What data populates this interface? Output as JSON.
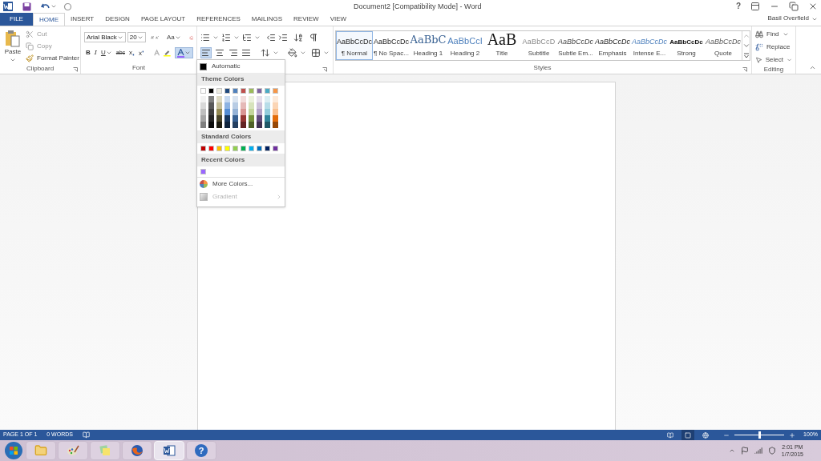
{
  "title_bar": {
    "title": "Document2 [Compatibility Mode] - Word",
    "help": "?",
    "user": "Basil Overfield"
  },
  "tabs": [
    {
      "label": "FILE",
      "kind": "file",
      "selected": false
    },
    {
      "label": "HOME",
      "kind": "tab",
      "selected": true
    },
    {
      "label": "INSERT",
      "kind": "tab",
      "selected": false
    },
    {
      "label": "DESIGN",
      "kind": "tab",
      "selected": false
    },
    {
      "label": "PAGE LAYOUT",
      "kind": "tab",
      "selected": false
    },
    {
      "label": "REFERENCES",
      "kind": "tab",
      "selected": false
    },
    {
      "label": "MAILINGS",
      "kind": "tab",
      "selected": false
    },
    {
      "label": "REVIEW",
      "kind": "tab",
      "selected": false
    },
    {
      "label": "VIEW",
      "kind": "tab",
      "selected": false
    }
  ],
  "clipboard": {
    "paste": "Paste",
    "cut": "Cut",
    "copy": "Copy",
    "format_painter": "Format Painter",
    "label": "Clipboard"
  },
  "font": {
    "font_name": "Arial Black",
    "font_size": "20",
    "change_case": "Aa",
    "bold": "B",
    "italic": "I",
    "underline": "U",
    "strikethrough": "abc",
    "label": "Font",
    "font_color_open": true
  },
  "paragraph": {
    "alignments": [
      {
        "kind": "left",
        "selected": true
      },
      {
        "kind": "center",
        "selected": false
      },
      {
        "kind": "right",
        "selected": false
      },
      {
        "kind": "justify",
        "selected": false
      }
    ]
  },
  "styles": {
    "label": "Styles",
    "items": [
      {
        "preview": "AaBbCcDc",
        "name": "¶ Normal",
        "kind": "normal",
        "selected": true
      },
      {
        "preview": "AaBbCcDc",
        "name": "¶ No Spac...",
        "kind": "normal",
        "selected": false
      },
      {
        "preview": "AaBbC",
        "name": "Heading 1",
        "kind": "heading1",
        "selected": false
      },
      {
        "preview": "AaBbCcI",
        "name": "Heading 2",
        "kind": "heading2",
        "selected": false
      },
      {
        "preview": "AaB",
        "name": "Title",
        "kind": "title",
        "selected": false
      },
      {
        "preview": "AaBbCcD",
        "name": "Subtitle",
        "kind": "subtitle",
        "selected": false
      },
      {
        "preview": "AaBbCcDc",
        "name": "Subtle Em...",
        "kind": "subtle",
        "selected": false
      },
      {
        "preview": "AaBbCcDc",
        "name": "Emphasis",
        "kind": "emphasis",
        "selected": false
      },
      {
        "preview": "AaBbCcDc",
        "name": "Intense E...",
        "kind": "intense",
        "selected": false
      },
      {
        "preview": "AaBbCcDc",
        "name": "Strong",
        "kind": "strong",
        "selected": false
      },
      {
        "preview": "AaBbCcDc",
        "name": "Quote",
        "kind": "quote",
        "selected": false
      }
    ]
  },
  "editing": {
    "find": "Find",
    "replace": "Replace",
    "select": "Select",
    "label": "Editing"
  },
  "color_menu": {
    "automatic": "Automatic",
    "theme_header": "Theme Colors",
    "theme_colors": [
      {
        "color": "#ffffff",
        "shades": [
          {
            "color": "#f2f2f2"
          },
          {
            "color": "#d9d9d9"
          },
          {
            "color": "#bfbfbf"
          },
          {
            "color": "#a6a6a6"
          },
          {
            "color": "#808080"
          }
        ]
      },
      {
        "color": "#000000",
        "shades": [
          {
            "color": "#808080"
          },
          {
            "color": "#595959"
          },
          {
            "color": "#404040"
          },
          {
            "color": "#262626"
          },
          {
            "color": "#0d0d0d"
          }
        ]
      },
      {
        "color": "#eeece1",
        "shades": [
          {
            "color": "#ddd9c3"
          },
          {
            "color": "#c4bd97"
          },
          {
            "color": "#948a54"
          },
          {
            "color": "#4a452a"
          },
          {
            "color": "#1e1c11"
          }
        ]
      },
      {
        "color": "#1f497d",
        "shades": [
          {
            "color": "#c6d9f0"
          },
          {
            "color": "#8db3e2"
          },
          {
            "color": "#548dd4"
          },
          {
            "color": "#17365d"
          },
          {
            "color": "#0f243e"
          }
        ]
      },
      {
        "color": "#4f81bd",
        "shades": [
          {
            "color": "#dbe5f1"
          },
          {
            "color": "#b8cce4"
          },
          {
            "color": "#95b3d7"
          },
          {
            "color": "#366092"
          },
          {
            "color": "#244061"
          }
        ]
      },
      {
        "color": "#c0504d",
        "shades": [
          {
            "color": "#f2dcdb"
          },
          {
            "color": "#e5b9b7"
          },
          {
            "color": "#d99694"
          },
          {
            "color": "#953734"
          },
          {
            "color": "#632423"
          }
        ]
      },
      {
        "color": "#9bbb59",
        "shades": [
          {
            "color": "#ebf1dd"
          },
          {
            "color": "#d7e3bc"
          },
          {
            "color": "#c3d69b"
          },
          {
            "color": "#76923c"
          },
          {
            "color": "#4f6128"
          }
        ]
      },
      {
        "color": "#8064a2",
        "shades": [
          {
            "color": "#e5e0ec"
          },
          {
            "color": "#ccc1d9"
          },
          {
            "color": "#b2a2c7"
          },
          {
            "color": "#5f497a"
          },
          {
            "color": "#3f3151"
          }
        ]
      },
      {
        "color": "#4bacc6",
        "shades": [
          {
            "color": "#dbeef3"
          },
          {
            "color": "#b7dde8"
          },
          {
            "color": "#92cddc"
          },
          {
            "color": "#31859b"
          },
          {
            "color": "#205867"
          }
        ]
      },
      {
        "color": "#f79646",
        "shades": [
          {
            "color": "#fdeada"
          },
          {
            "color": "#fbd5b5"
          },
          {
            "color": "#fac08f"
          },
          {
            "color": "#e36c09"
          },
          {
            "color": "#974806"
          }
        ]
      }
    ],
    "standard_header": "Standard Colors",
    "standard_colors": [
      {
        "color": "#c00000"
      },
      {
        "color": "#ff0000"
      },
      {
        "color": "#ffc000"
      },
      {
        "color": "#ffff00"
      },
      {
        "color": "#92d050"
      },
      {
        "color": "#00b050"
      },
      {
        "color": "#00b0f0"
      },
      {
        "color": "#0070c0"
      },
      {
        "color": "#002060"
      },
      {
        "color": "#7030a0"
      }
    ],
    "recent_header": "Recent Colors",
    "recent_colors": [
      {
        "color": "#9966ff"
      }
    ],
    "more_colors": "More Colors...",
    "gradient": {
      "label": "Gradient",
      "disabled": true
    }
  },
  "status_bar": {
    "page": "PAGE 1 OF 1",
    "words": "0 WORDS",
    "views": [
      {
        "kind": "read",
        "selected": false
      },
      {
        "kind": "print",
        "selected": true
      },
      {
        "kind": "web",
        "selected": false
      }
    ],
    "zoom_slider": {
      "level": 0.5
    },
    "zoom": "100%"
  },
  "taskbar": {
    "help": "?",
    "time": "2:01 PM",
    "date": "1/7/2015"
  }
}
